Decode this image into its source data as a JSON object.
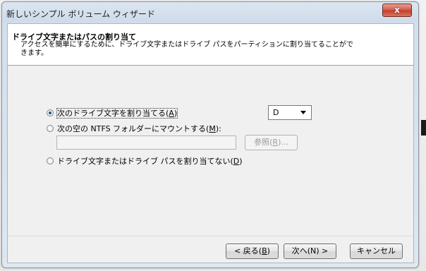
{
  "window": {
    "title": "新しいシンプル ボリューム ウィザード",
    "close_label": "x"
  },
  "header": {
    "title": "ドライブ文字またはパスの割り当て",
    "description": "アクセスを簡単にするために、ドライブ文字またはドライブ パスをパーティションに割り当てることができます。"
  },
  "options": [
    {
      "label_pre": "次のドライブ文字を割り当てる(",
      "mnemonic": "A",
      "label_post": ")",
      "checked": true
    },
    {
      "label_pre": "次の空の NTFS フォルダーにマウントする(",
      "mnemonic": "M",
      "label_post": "):",
      "checked": false
    },
    {
      "label_pre": "ドライブ文字またはドライブ パスを割り当てない(",
      "mnemonic": "D",
      "label_post": ")",
      "checked": false
    }
  ],
  "drive_combo": {
    "value": "D",
    "icon": "chevron-down-icon"
  },
  "mount_path": {
    "value": "",
    "placeholder": ""
  },
  "browse_button": {
    "label_pre": "参照(",
    "mnemonic": "R",
    "label_post": ")..."
  },
  "nav": {
    "back": {
      "label_pre": "< 戻る(",
      "mnemonic": "B",
      "label_post": ")"
    },
    "next": {
      "label": "次へ(N) >"
    },
    "cancel": {
      "label": "キャンセル"
    }
  },
  "colors": {
    "close_button": "#c33e2a",
    "frame": "#cfdbea",
    "dialog_bg": "#f0f0f0"
  }
}
